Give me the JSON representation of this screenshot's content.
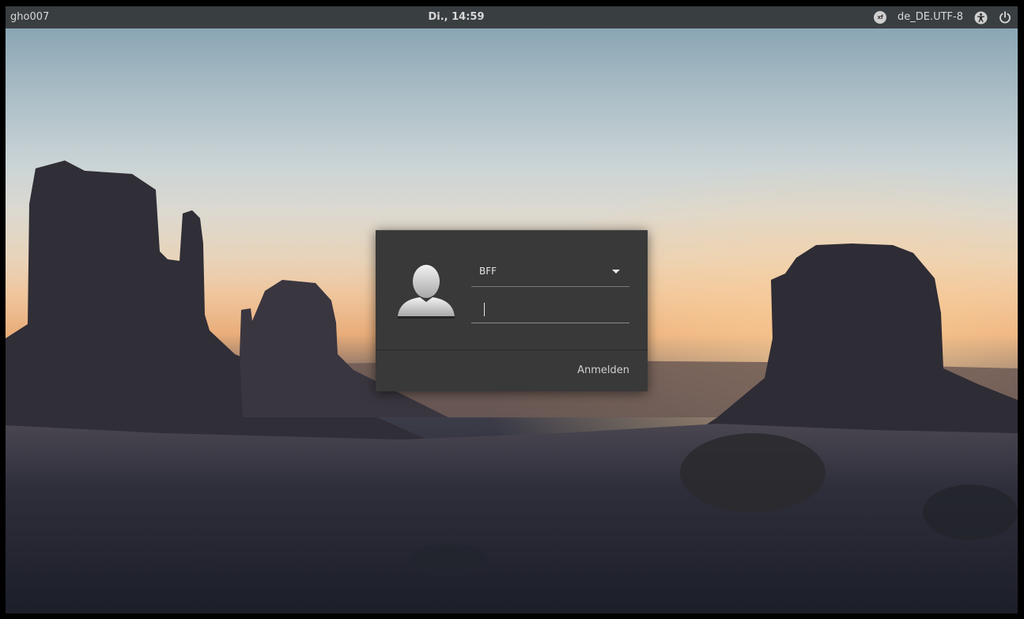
{
  "topbar": {
    "hostname": "gho007",
    "clock": "Di., 14:59",
    "keyboard_layout_badge": "xf",
    "language": "de_DE.UTF-8",
    "icons": [
      "keyboard-layout-icon",
      "accessibility-icon",
      "power-icon"
    ]
  },
  "login": {
    "selected_user": "BFF",
    "password_value": "",
    "login_button_label": "Anmelden"
  },
  "colors": {
    "panel_bg": "#393939",
    "topbar_bg": "#282828",
    "text": "#d8d8d8"
  }
}
